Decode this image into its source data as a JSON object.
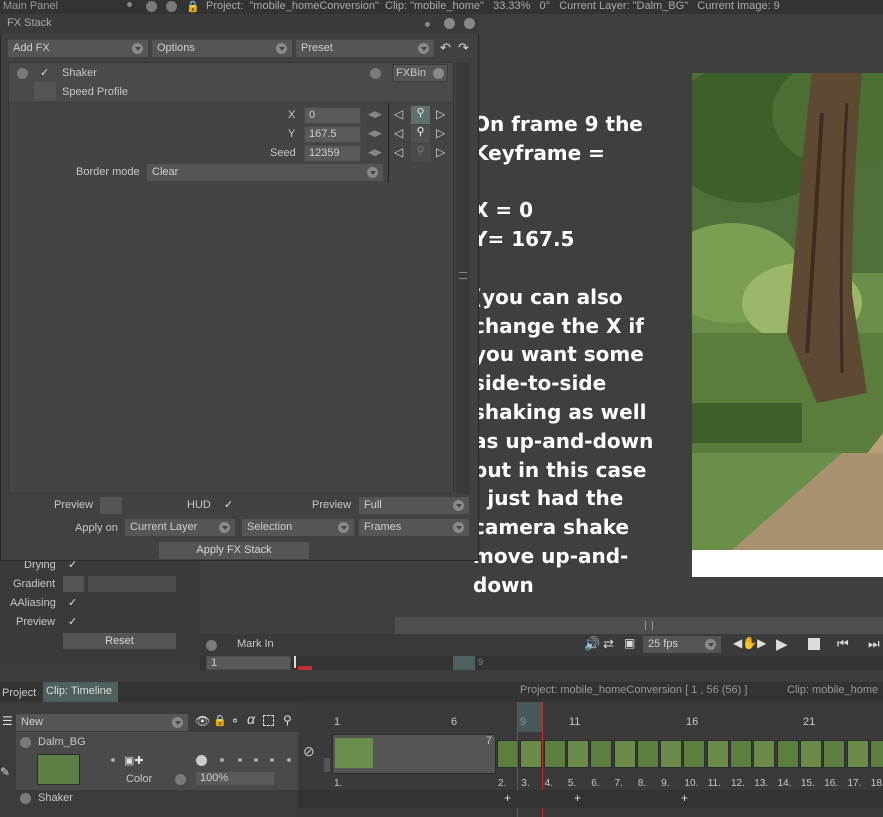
{
  "topbar": {
    "main_panel": "Main Panel",
    "project_info": "Project:  \"mobile_homeConversion\"  Clip: \"mobile_home\"   33.33%   0°   Current Layer: \"Dalm_BG\"   Current Image: 9"
  },
  "fx_stack": {
    "title": "FX Stack",
    "add_fx": "Add FX",
    "options": "Options",
    "preset": "Preset",
    "effect_name": "Shaker",
    "speed_profile": "Speed Profile",
    "fxbin": "FXBin",
    "params": [
      {
        "label": "X",
        "value": "0"
      },
      {
        "label": "Y",
        "value": "167.5"
      },
      {
        "label": "Seed",
        "value": "12359"
      }
    ],
    "border_mode_label": "Border mode",
    "border_mode_value": "Clear",
    "preview_label": "Preview",
    "hud_label": "HUD",
    "preview2_label": "Preview",
    "preview2_value": "Full",
    "apply_on_label": "Apply on",
    "apply_on_value": "Current Layer",
    "selection_value": "Selection",
    "frames_value": "Frames",
    "apply_button": "Apply FX Stack"
  },
  "left_panel": {
    "drying": "Drying",
    "gradient": "Gradient",
    "aaliasing": "AAliasing",
    "preview": "Preview",
    "reset": "Reset"
  },
  "annotation": {
    "lines": [
      "On frame 9 the",
      "Keyframe =",
      "",
      "X = 0",
      "Y= 167.5",
      "",
      "(you can also",
      "change the X if",
      "you want some",
      "side-to-side",
      "shaking as well",
      "as up-and-down",
      "but in this case",
      "I just had the",
      "camera shake",
      "move up-and-down"
    ]
  },
  "playback": {
    "mark_in": "Mark In",
    "fps": "25 fps",
    "frame_field": "1",
    "frame_marker": "9"
  },
  "timeline": {
    "tab_project": "Project",
    "tab_timeline": "Clip: Timeline",
    "project_info": "Project: mobile_homeConversion [ 1 , 56  (56) ]",
    "clip_info": "Clip: mobile_home",
    "new_label": "New",
    "layer_name": "Dalm_BG",
    "color_label": "Color",
    "opacity_value": "100%",
    "shaker_label": "Shaker",
    "ruler_labels": [
      "1",
      "6",
      "9",
      "11",
      "16",
      "21"
    ],
    "frame_numbers": [
      "1.",
      "2.",
      "3.",
      "4.",
      "5.",
      "6.",
      "7.",
      "8.",
      "9.",
      "10.",
      "11.",
      "12.",
      "13.",
      "14.",
      "15.",
      "16.",
      "17.",
      "18."
    ],
    "first_cell_count": "7"
  },
  "colors": {
    "panel_bg": "#3f3f3f",
    "accent_red": "#c03030",
    "timeline_tab": "#4d5f5f"
  }
}
